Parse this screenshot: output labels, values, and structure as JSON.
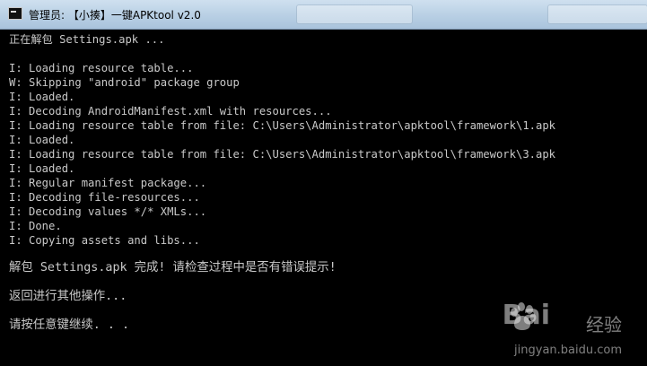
{
  "window": {
    "title": "管理员: 【小揍】一键APKtool v2.0",
    "background_tabs": [
      "",
      ""
    ]
  },
  "console": {
    "lines": [
      "正在解包 Settings.apk ...",
      "",
      "I: Loading resource table...",
      "W: Skipping \"android\" package group",
      "I: Loaded.",
      "I: Decoding AndroidManifest.xml with resources...",
      "I: Loading resource table from file: C:\\Users\\Administrator\\apktool\\framework\\1.apk",
      "I: Loaded.",
      "I: Loading resource table from file: C:\\Users\\Administrator\\apktool\\framework\\3.apk",
      "I: Loaded.",
      "I: Regular manifest package...",
      "I: Decoding file-resources...",
      "I: Decoding values */* XMLs...",
      "I: Done.",
      "I: Copying assets and libs...",
      "",
      "解包 Settings.apk 完成! 请检查过程中是否有错误提示!",
      "",
      "返回进行其他操作...",
      "",
      "请按任意键继续. . ."
    ]
  },
  "watermark": {
    "logo": "Bai",
    "logo_suffix": "经验",
    "url": "jingyan.baidu.com"
  },
  "colors": {
    "console_text": "#c9c9c9",
    "console_bg": "#000000"
  }
}
